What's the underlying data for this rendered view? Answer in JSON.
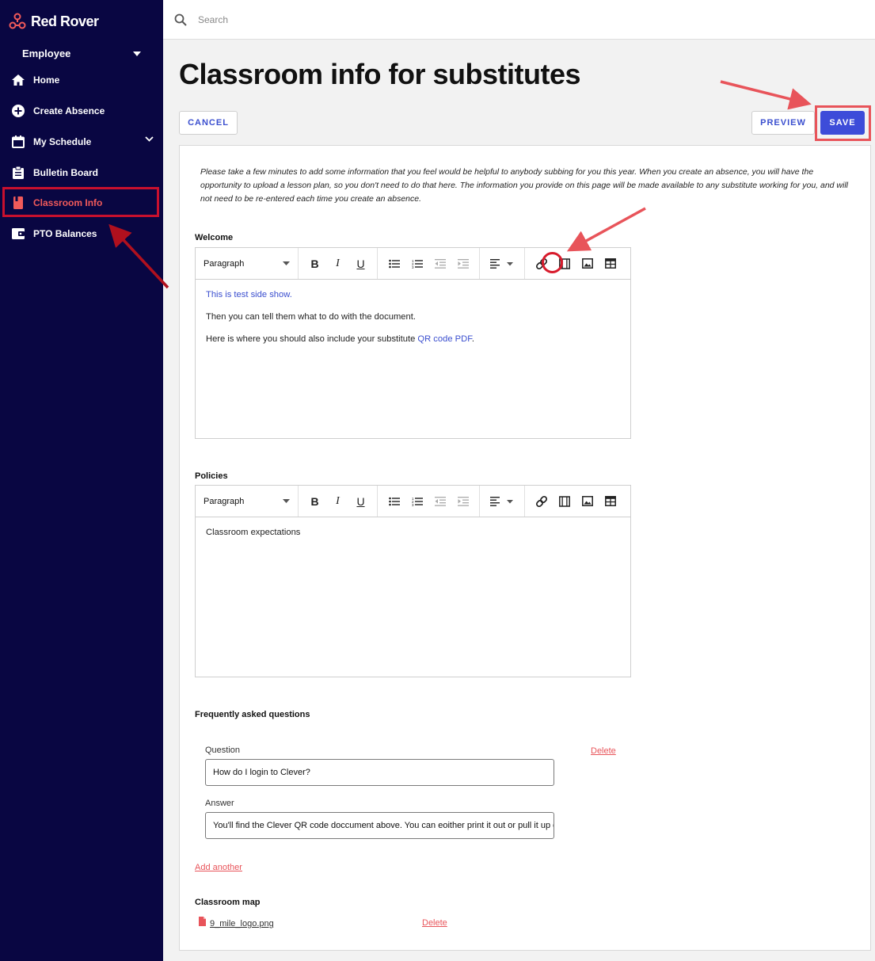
{
  "brand": {
    "name": "Red Rover"
  },
  "sidebar": {
    "role": "Employee",
    "items": [
      {
        "label": "Home",
        "icon": "home-icon"
      },
      {
        "label": "Create Absence",
        "icon": "plus-circle-icon"
      },
      {
        "label": "My Schedule",
        "icon": "calendar-icon"
      },
      {
        "label": "Bulletin Board",
        "icon": "clipboard-icon"
      },
      {
        "label": "Classroom Info",
        "icon": "book-icon"
      },
      {
        "label": "PTO Balances",
        "icon": "wallet-icon"
      }
    ]
  },
  "search": {
    "placeholder": "Search"
  },
  "page": {
    "title": "Classroom info for substitutes",
    "cancel_label": "CANCEL",
    "preview_label": "PREVIEW",
    "save_label": "SAVE",
    "intro": "Please take a few minutes to add some information that you feel would be helpful to anybody subbing for you this year. When you create an absence, you will have the opportunity to upload a lesson plan, so you don't need to do that here. The information you provide on this page will be made available to any substitute working for you, and will not need to be re-entered each time you create an absence."
  },
  "editor_toolbar": {
    "format": "Paragraph"
  },
  "welcome": {
    "label": "Welcome",
    "line1": "This is test side show.",
    "line2": "Then you can tell them what to do with the document.",
    "line3_prefix": "Here is where you should also include your substitute ",
    "line3_link": "QR code PDF",
    "line3_suffix": "."
  },
  "policies": {
    "label": "Policies",
    "line1": "Classroom expectations"
  },
  "faq": {
    "label": "Frequently asked questions",
    "question_label": "Question",
    "question_value": "How do I login to Clever?",
    "answer_label": "Answer",
    "answer_value": "You'll find the Clever QR code doccument above. You can eoither print it out or pull it up on your phone.",
    "delete_label": "Delete",
    "add_another_label": "Add another"
  },
  "classroom_map": {
    "label": "Classroom map",
    "file_name": "9_mile_logo.png",
    "delete_label": "Delete"
  },
  "colors": {
    "sidebar_bg": "#090642",
    "accent": "#3d4cd9",
    "brand_red": "#f25a5a",
    "annotation_red": "#e8545a"
  }
}
